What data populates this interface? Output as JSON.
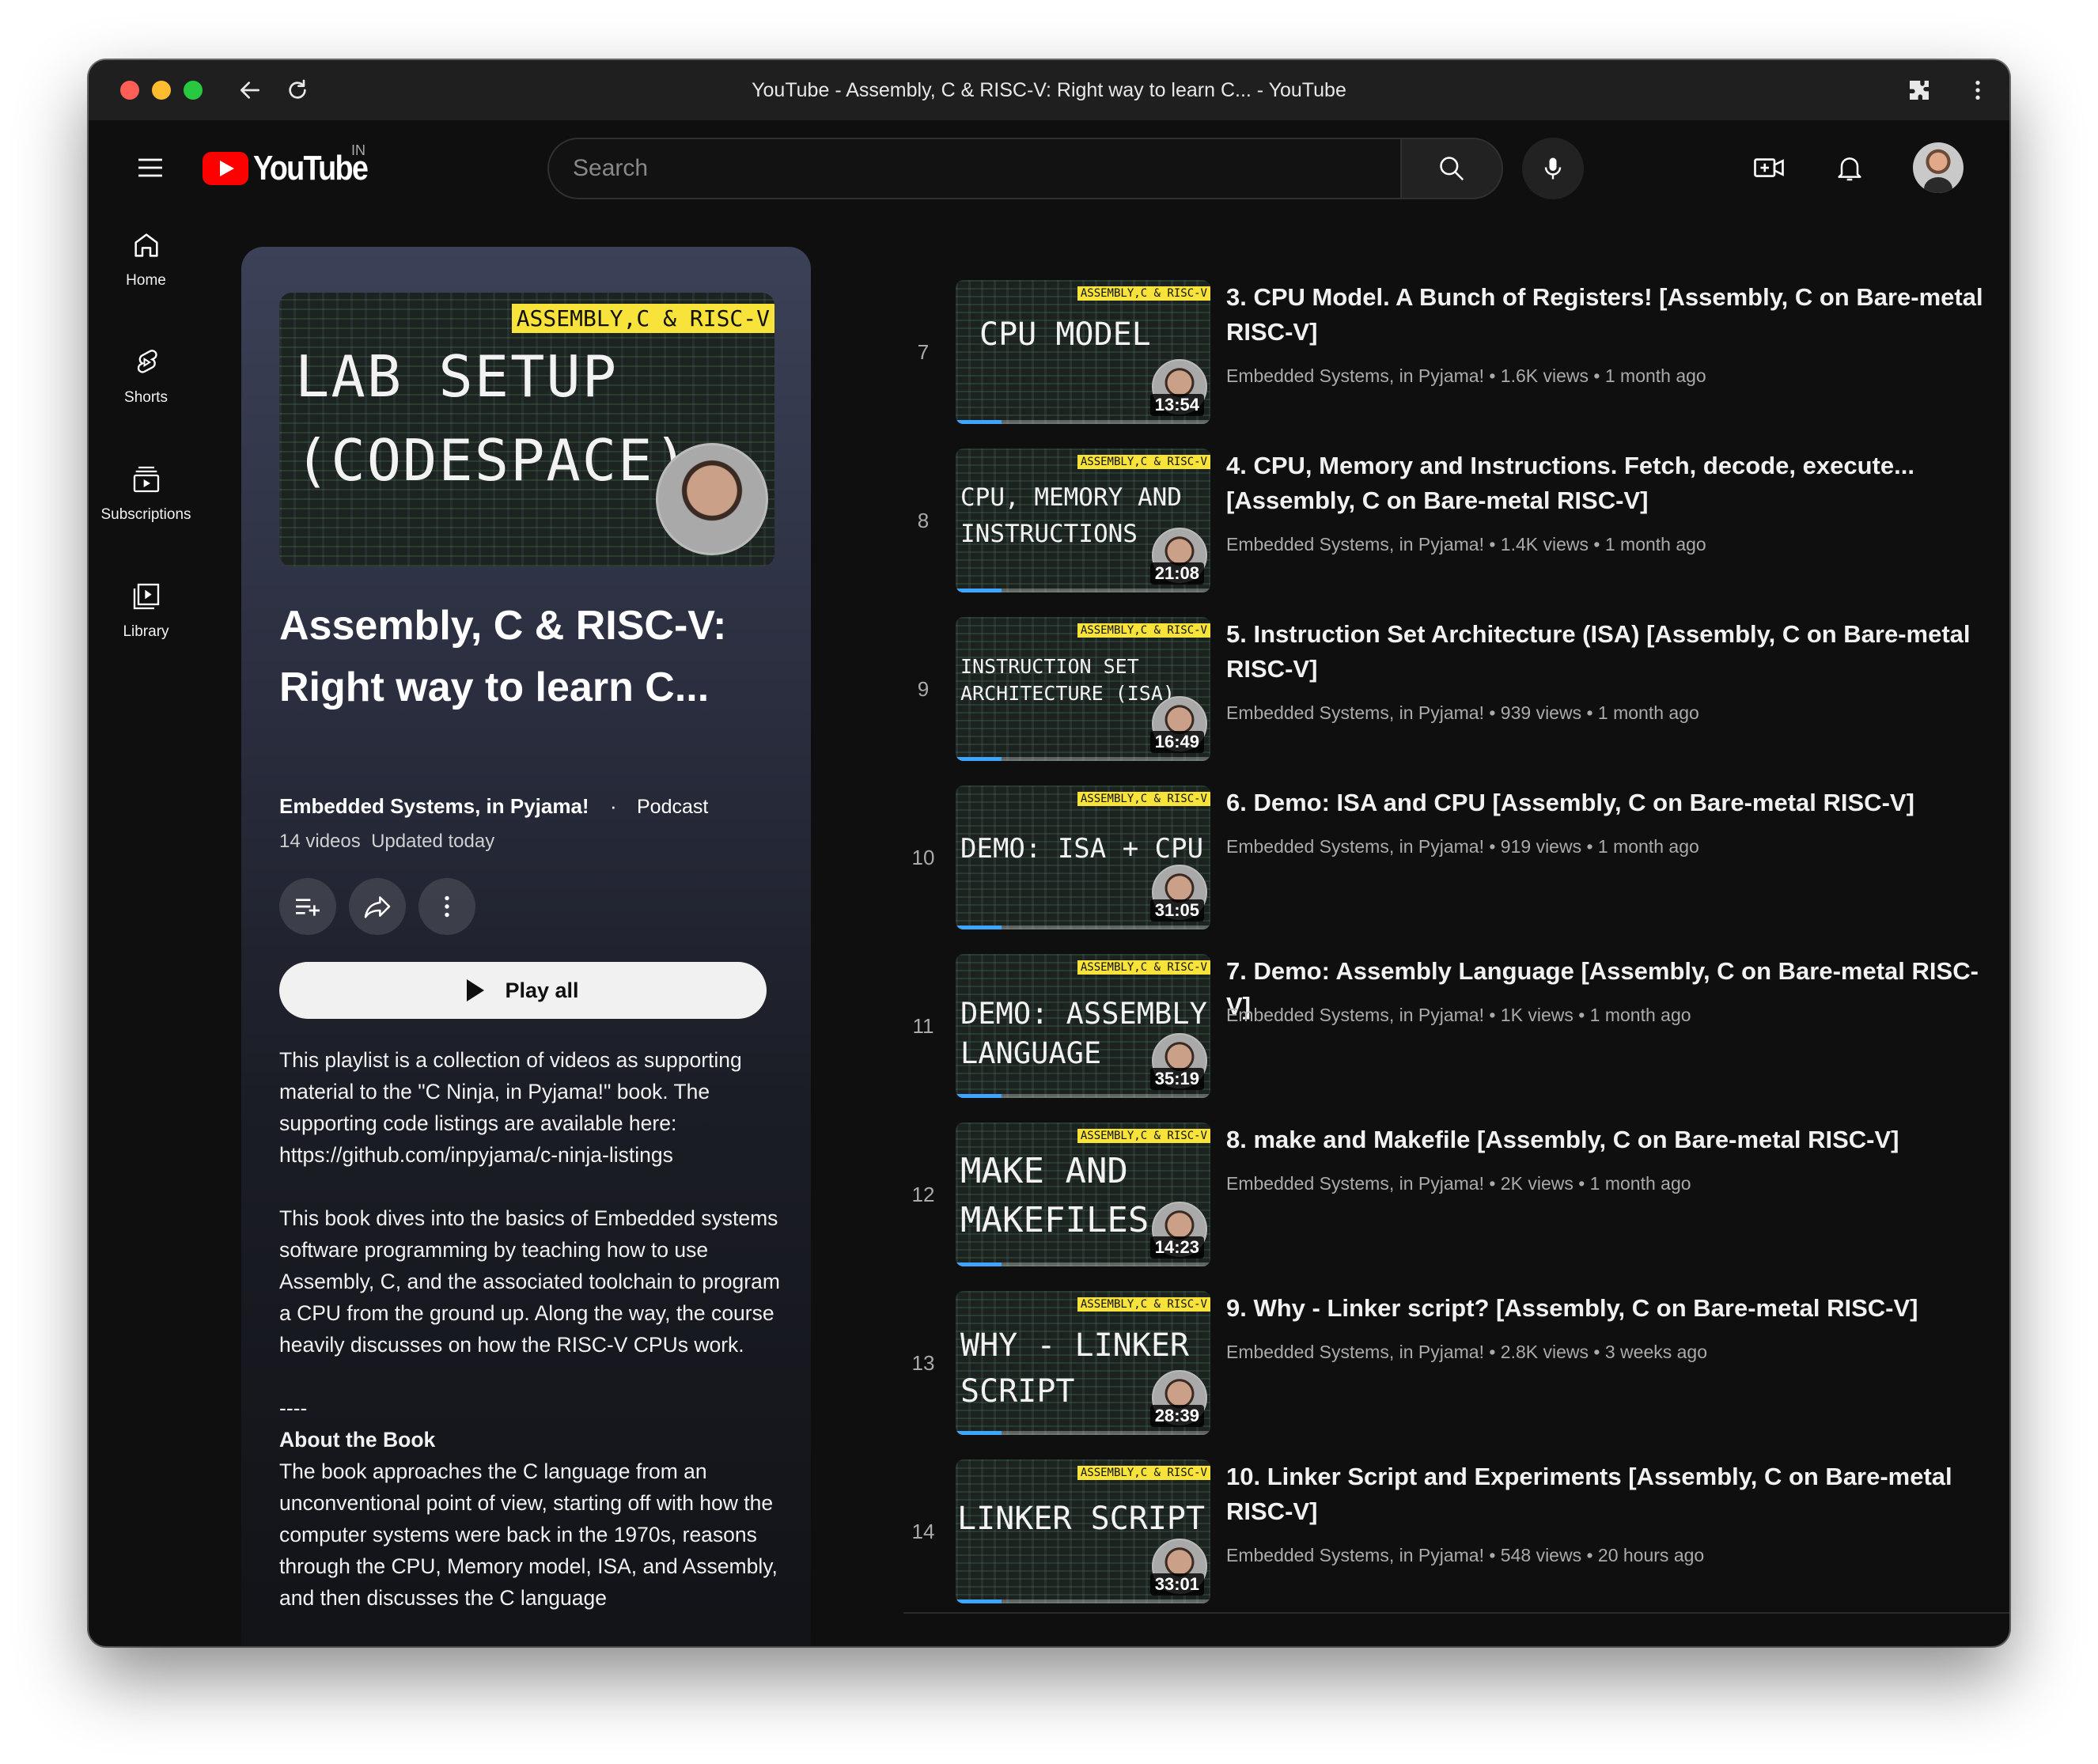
{
  "window": {
    "title": "YouTube - Assembly, C & RISC-V: Right way to learn C... - YouTube"
  },
  "header": {
    "logo_text": "YouTube",
    "region": "IN",
    "search_placeholder": "Search"
  },
  "sidebar": {
    "items": [
      {
        "label": "Home",
        "icon": "home-icon"
      },
      {
        "label": "Shorts",
        "icon": "shorts-icon"
      },
      {
        "label": "Subscriptions",
        "icon": "subscriptions-icon"
      },
      {
        "label": "Library",
        "icon": "library-icon"
      }
    ]
  },
  "playlist": {
    "hero_tag": "ASSEMBLY,C & RISC-V",
    "hero_line1": "LAB SETUP",
    "hero_line2": "(CODESPACE)",
    "title_line1": "Assembly, C & RISC-V:",
    "title_line2": "Right way to learn C...",
    "owner": "Embedded Systems, in Pyjama!",
    "separator": "·",
    "type": "Podcast",
    "meta": "14 videos  Updated today",
    "play_all": "Play all",
    "description": [
      "This playlist is a collection of videos as supporting material to the \"C Ninja, in Pyjama!\" book. The supporting code listings are available here: https://github.com/inpyjama/c-ninja-listings",
      "This book dives into the basics of Embedded systems software programming by teaching how to use Assembly, C, and the associated toolchain to program a CPU from the ground up. Along the way, the course heavily discusses on how the RISC-V CPUs work.",
      "----",
      "About the Book",
      "The book approaches the C language from an unconventional point of view, starting off with how the computer systems were back in the 1970s, reasons through the CPU, Memory model, ISA, and Assembly, and then discusses the C language"
    ]
  },
  "videos": [
    {
      "index": "7",
      "title": "3. CPU Model. A Bunch of Registers! [Assembly, C on Bare-metal RISC-V]",
      "meta": "Embedded Systems, in Pyjama! • 1.6K views • 1 month ago",
      "duration": "13:54",
      "thumb_tag": "ASSEMBLY,C & RISC-V",
      "thumb_line1": "CPU MODEL",
      "thumb_line2": ""
    },
    {
      "index": "8",
      "title": "4. CPU, Memory and Instructions. Fetch, decode, execute... [Assembly, C on Bare-metal RISC-V]",
      "meta": "Embedded Systems, in Pyjama! • 1.4K views • 1 month ago",
      "duration": "21:08",
      "thumb_tag": "ASSEMBLY,C & RISC-V",
      "thumb_line1": "CPU, MEMORY AND",
      "thumb_line2": "INSTRUCTIONS"
    },
    {
      "index": "9",
      "title": "5. Instruction Set Architecture (ISA) [Assembly, C on Bare-metal RISC-V]",
      "meta": "Embedded Systems, in Pyjama! • 939 views • 1 month ago",
      "duration": "16:49",
      "thumb_tag": "ASSEMBLY,C & RISC-V",
      "thumb_line1": "INSTRUCTION SET",
      "thumb_line2": "ARCHITECTURE (ISA)"
    },
    {
      "index": "10",
      "title": "6. Demo: ISA and CPU [Assembly, C on Bare-metal RISC-V]",
      "meta": "Embedded Systems, in Pyjama! • 919 views • 1 month ago",
      "duration": "31:05",
      "thumb_tag": "ASSEMBLY,C & RISC-V",
      "thumb_line1": "DEMO: ISA + CPU",
      "thumb_line2": ""
    },
    {
      "index": "11",
      "title": "7. Demo: Assembly Language [Assembly, C on Bare-metal RISC-V]",
      "meta": "Embedded Systems, in Pyjama! • 1K views • 1 month ago",
      "duration": "35:19",
      "thumb_tag": "ASSEMBLY,C & RISC-V",
      "thumb_line1": "DEMO: ASSEMBLY",
      "thumb_line2": "LANGUAGE"
    },
    {
      "index": "12",
      "title": "8. make and Makefile [Assembly, C on Bare-metal RISC-V]",
      "meta": "Embedded Systems, in Pyjama! • 2K views • 1 month ago",
      "duration": "14:23",
      "thumb_tag": "ASSEMBLY,C & RISC-V",
      "thumb_line1": "MAKE AND",
      "thumb_line2": "MAKEFILES"
    },
    {
      "index": "13",
      "title": "9. Why - Linker script? [Assembly, C on Bare-metal RISC-V]",
      "meta": "Embedded Systems, in Pyjama! • 2.8K views • 3 weeks ago",
      "duration": "28:39",
      "thumb_tag": "ASSEMBLY,C & RISC-V",
      "thumb_line1": "WHY - LINKER",
      "thumb_line2": "SCRIPT"
    },
    {
      "index": "14",
      "title": "10. Linker Script and Experiments [Assembly, C on Bare-metal RISC-V]",
      "meta": "Embedded Systems, in Pyjama! • 548 views • 20 hours ago",
      "duration": "33:01",
      "thumb_tag": "ASSEMBLY,C & RISC-V",
      "thumb_line1": "LINKER SCRIPT",
      "thumb_line2": ""
    }
  ],
  "colors": {
    "background": "#0f0f0f",
    "brand_red": "#ff0000",
    "thumb_tag": "#f7e33a",
    "progress": "#3ea6ff"
  }
}
